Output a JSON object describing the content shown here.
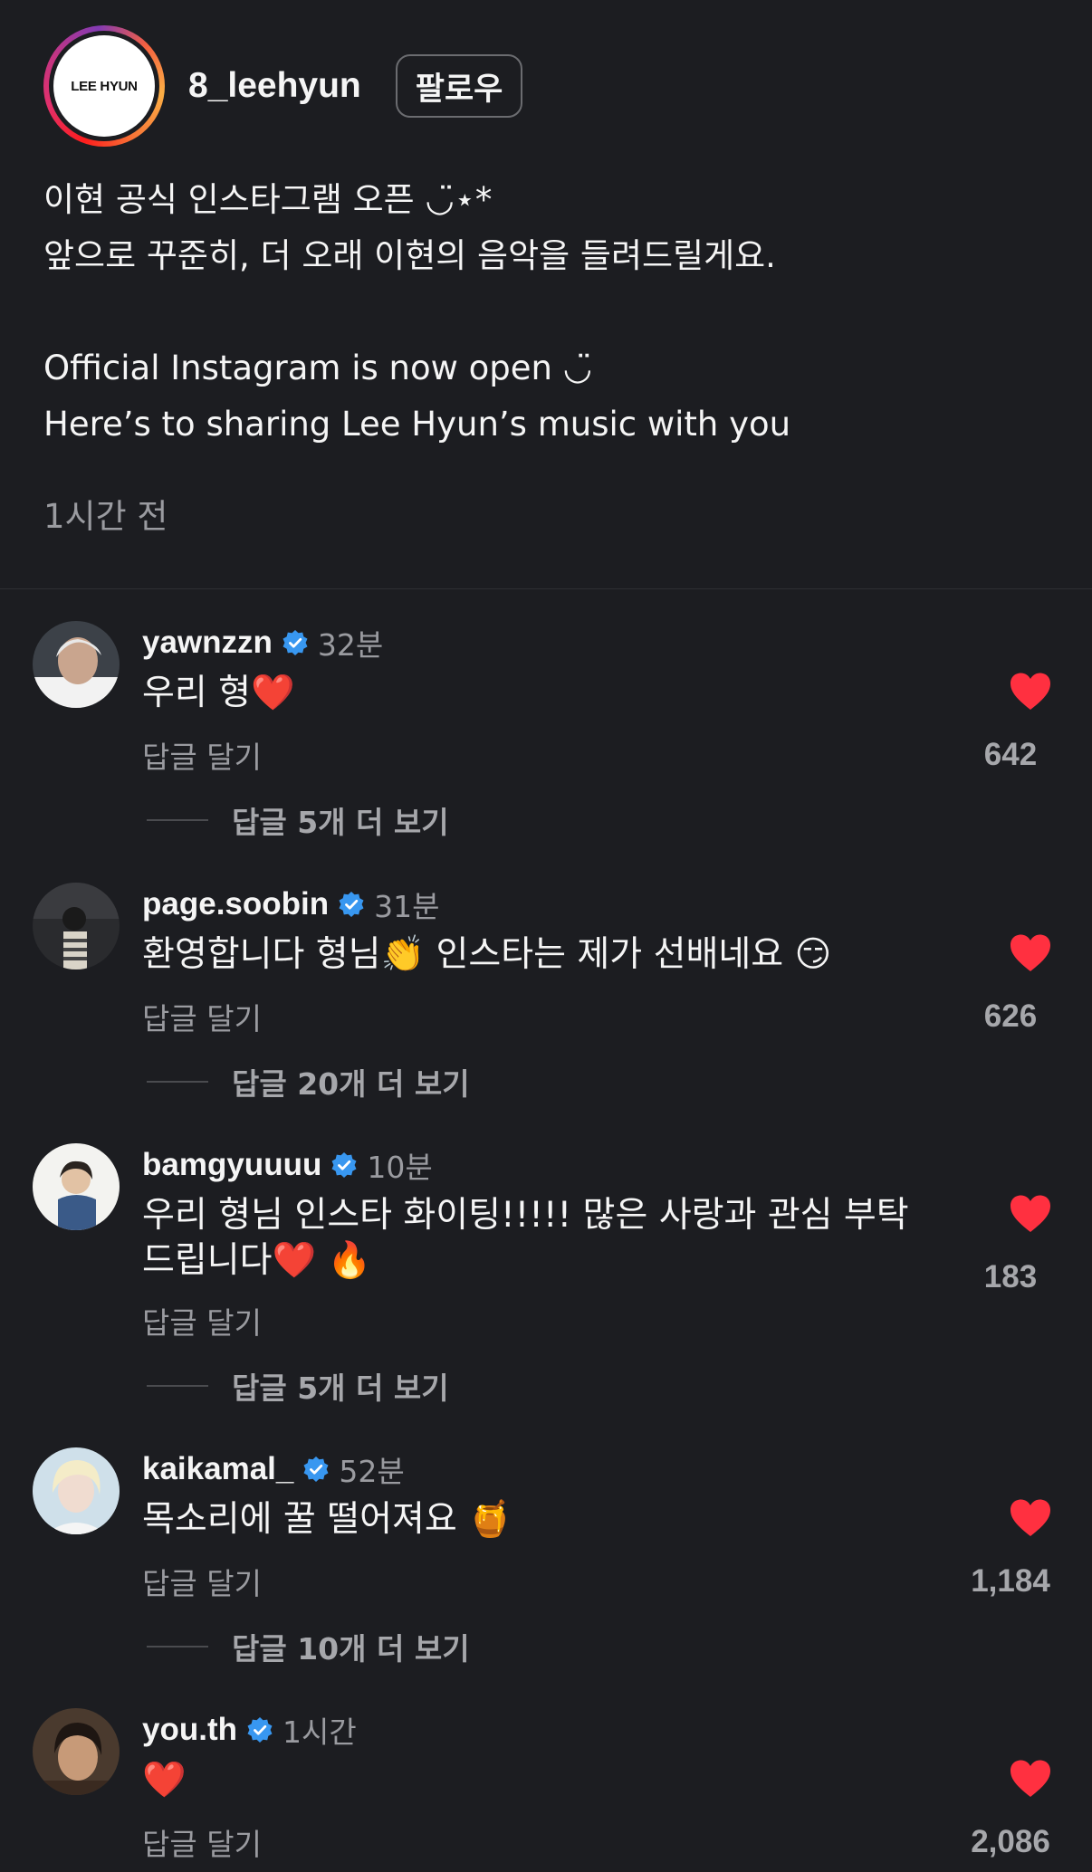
{
  "post": {
    "avatar_text": "LEE HYUN",
    "username": "8_leehyun",
    "follow_label": "팔로우",
    "caption_lines": [
      "이현 공식 인스타그램 오픈 ◡̈⋆*",
      "앞으로 꾸준히, 더 오래 이현의 음악을 들려드릴게요.",
      "",
      "Official Instagram is now open ◡̈",
      "Here’s to sharing Lee Hyun’s music with you"
    ],
    "time_ago": "1시간 전"
  },
  "comments": [
    {
      "username": "yawnzzn",
      "time": "32분",
      "text": "우리 형❤️",
      "reply_label": "답글 달기",
      "more_replies": "답글 5개 더 보기",
      "likes": "642"
    },
    {
      "username": "page.soobin",
      "time": "31분",
      "text": "환영합니다 형님👏 인스타는 제가 선배네요 😏",
      "reply_label": "답글 달기",
      "more_replies": "답글 20개 더 보기",
      "likes": "626"
    },
    {
      "username": "bamgyuuuu",
      "time": "10분",
      "text": "우리 형님 인스타 화이팅!!!!! 많은 사랑과 관심 부탁드립니다❤️ 🔥",
      "reply_label": "답글 달기",
      "more_replies": "답글 5개 더 보기",
      "likes": "183"
    },
    {
      "username": "kaikamal_",
      "time": "52분",
      "text": "목소리에 꿀 떨어져요 🍯",
      "reply_label": "답글 달기",
      "more_replies": "답글 10개 더 보기",
      "likes": "1,184"
    },
    {
      "username": "you.th",
      "time": "1시간",
      "text": "❤️",
      "reply_label": "답글 달기",
      "likes": "2,086"
    }
  ],
  "colors": {
    "background": "#1c1d21",
    "verified": "#3897f0",
    "like_heart": "#ff3040",
    "muted_text": "#9a9ba0"
  },
  "icons": {
    "verified": "verified-badge-icon",
    "like": "heart-filled-icon"
  }
}
